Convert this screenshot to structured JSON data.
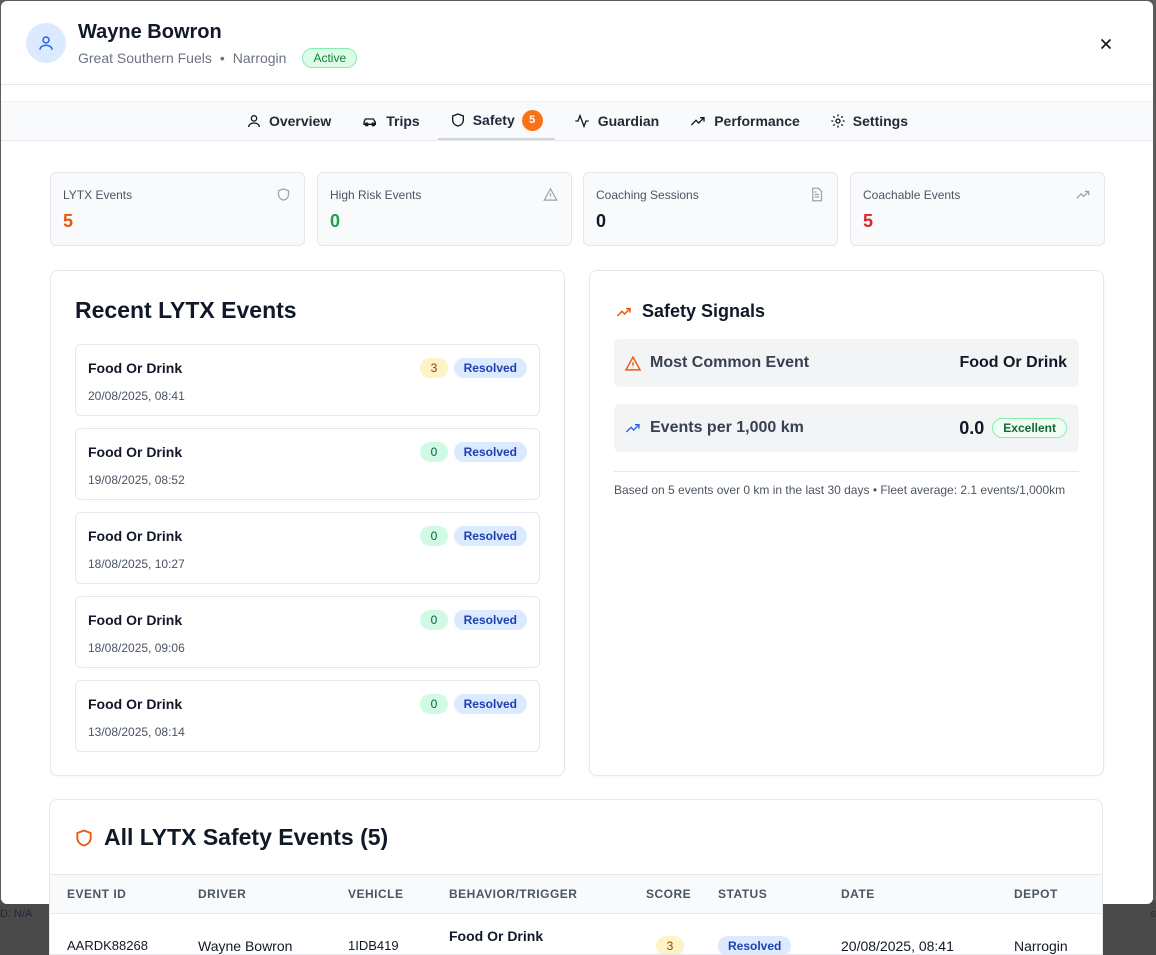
{
  "backdrop": {
    "left_text": "D: N/A",
    "right_text": "s"
  },
  "driver": {
    "name": "Wayne Bowron",
    "company": "Great Southern Fuels",
    "separator": "•",
    "depot": "Narrogin",
    "status": "Active"
  },
  "tabs": [
    {
      "label": "Overview",
      "icon": "user-icon"
    },
    {
      "label": "Trips",
      "icon": "car-icon"
    },
    {
      "label": "Safety",
      "icon": "shield-icon",
      "count": "5",
      "active": true
    },
    {
      "label": "Guardian",
      "icon": "activity-icon"
    },
    {
      "label": "Performance",
      "icon": "trending-up-icon"
    },
    {
      "label": "Settings",
      "icon": "gear-icon"
    }
  ],
  "stats": [
    {
      "label": "LYTX Events",
      "value": "5",
      "color": "#ea580c",
      "icon": "shield-icon"
    },
    {
      "label": "High Risk Events",
      "value": "0",
      "color": "#16a34a",
      "icon": "alert-triangle-icon"
    },
    {
      "label": "Coaching Sessions",
      "value": "0",
      "color": "#111827",
      "icon": "document-icon"
    },
    {
      "label": "Coachable Events",
      "value": "5",
      "color": "#dc2626",
      "icon": "trending-up-icon"
    }
  ],
  "recent": {
    "title": "Recent LYTX Events",
    "events": [
      {
        "title": "Food Or Drink",
        "date": "20/08/2025, 08:41",
        "score": "3",
        "status": "Resolved"
      },
      {
        "title": "Food Or Drink",
        "date": "19/08/2025, 08:52",
        "score": "0",
        "status": "Resolved"
      },
      {
        "title": "Food Or Drink",
        "date": "18/08/2025, 10:27",
        "score": "0",
        "status": "Resolved"
      },
      {
        "title": "Food Or Drink",
        "date": "18/08/2025, 09:06",
        "score": "0",
        "status": "Resolved"
      },
      {
        "title": "Food Or Drink",
        "date": "13/08/2025, 08:14",
        "score": "0",
        "status": "Resolved"
      }
    ]
  },
  "signals": {
    "title": "Safety Signals",
    "most_common_label": "Most Common Event",
    "most_common_value": "Food Or Drink",
    "per_km_label": "Events per 1,000 km",
    "per_km_value": "0.0",
    "per_km_badge": "Excellent",
    "note": "Based on 5 events over 0 km in the last 30 days • Fleet average: 2.1 events/1,000km"
  },
  "all_events": {
    "title": "All LYTX Safety Events (5)",
    "columns": [
      "Event ID",
      "Driver",
      "Vehicle",
      "Behavior/Trigger",
      "Score",
      "Status",
      "Date",
      "Depot"
    ],
    "rows": [
      {
        "event_id": "AARDK88268",
        "driver": "Wayne Bowron",
        "vehicle": "1IDB419",
        "behavior": "Food Or Drink",
        "score": "3",
        "status": "Resolved",
        "date": "20/08/2025, 08:41",
        "depot": "Narrogin"
      }
    ]
  },
  "colors": {
    "accent_orange": "#f97316",
    "resolved_bg": "#dbeafe",
    "active_green": "#15803d"
  }
}
